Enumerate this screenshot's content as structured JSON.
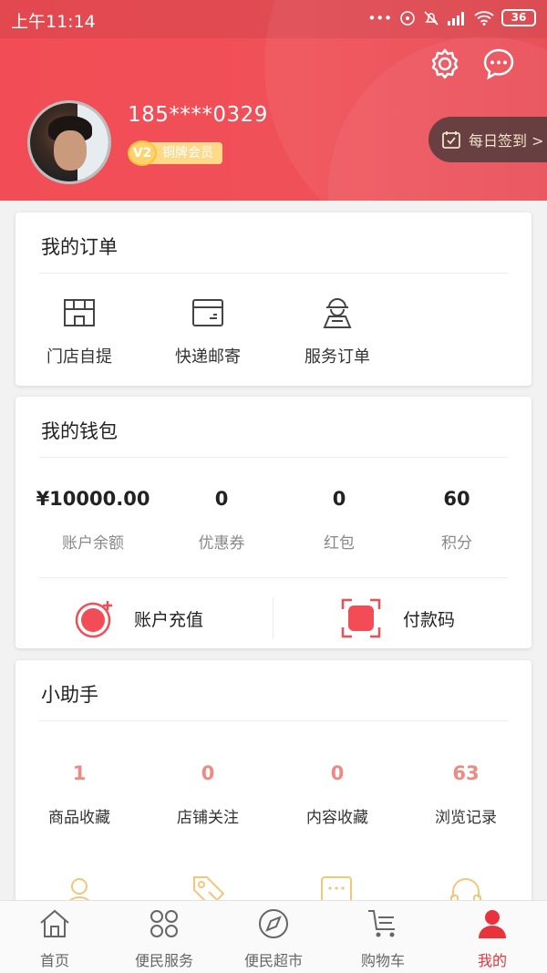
{
  "status_bar": {
    "time": "上午11:14",
    "battery": "36"
  },
  "header": {
    "phone": "185****0329",
    "level": "V2",
    "member_label": "铜牌会员",
    "checkin_label": "每日签到 >"
  },
  "orders": {
    "title": "我的订单",
    "items": [
      {
        "label": "门店自提",
        "icon": "store-icon"
      },
      {
        "label": "快递邮寄",
        "icon": "parcel-icon"
      },
      {
        "label": "服务订单",
        "icon": "service-person-icon"
      }
    ]
  },
  "wallet": {
    "title": "我的钱包",
    "stats": [
      {
        "value": "¥10000.00",
        "label": "账户余额"
      },
      {
        "value": "0",
        "label": "优惠券"
      },
      {
        "value": "0",
        "label": "红包"
      },
      {
        "value": "60",
        "label": "积分"
      }
    ],
    "recharge_label": "账户充值",
    "paycode_label": "付款码"
  },
  "helper": {
    "title": "小助手",
    "stats": [
      {
        "value": "1",
        "label": "商品收藏"
      },
      {
        "value": "0",
        "label": "店铺关注"
      },
      {
        "value": "0",
        "label": "内容收藏"
      },
      {
        "value": "63",
        "label": "浏览记录"
      }
    ]
  },
  "tabbar": {
    "items": [
      {
        "label": "首页",
        "icon": "home-icon"
      },
      {
        "label": "便民服务",
        "icon": "grid-icon"
      },
      {
        "label": "便民超市",
        "icon": "compass-icon"
      },
      {
        "label": "购物车",
        "icon": "cart-icon"
      },
      {
        "label": "我的",
        "icon": "profile-icon"
      }
    ],
    "active": "我的"
  },
  "colors": {
    "brand_red": "#f24d56",
    "active_tab": "#e8333c",
    "helper_number": "#ef8983",
    "icon_gold": "#f2c779"
  }
}
